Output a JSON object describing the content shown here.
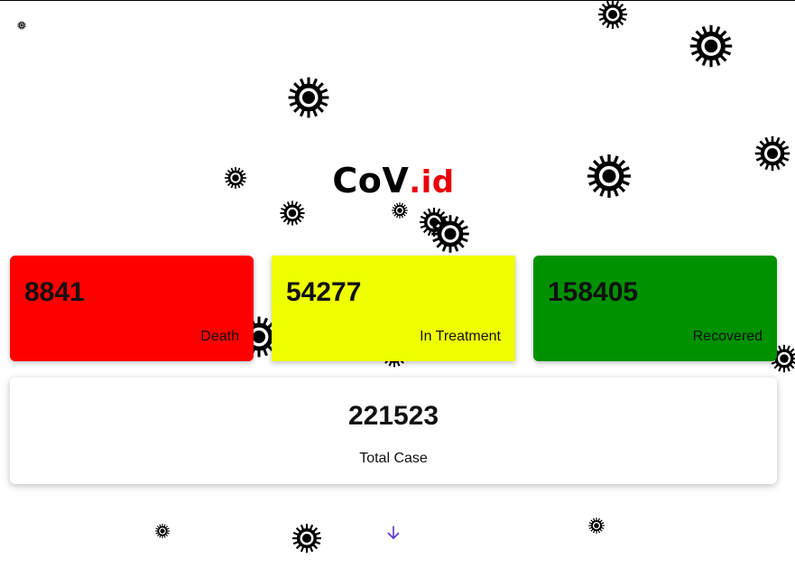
{
  "logo": {
    "main": "CoV",
    "suffix": ".id"
  },
  "stats": {
    "death": {
      "value": "8841",
      "label": "Death"
    },
    "treatment": {
      "value": "54277",
      "label": "In Treatment"
    },
    "recovered": {
      "value": "158405",
      "label": "Recovered"
    }
  },
  "total": {
    "value": "221523",
    "label": "Total Case"
  },
  "scroll": {
    "icon": "arrow-down-icon"
  },
  "decor": {
    "icon": "virus-icon"
  },
  "colors": {
    "death": "#fe0000",
    "treatment": "#eeff00",
    "recovered": "#009100",
    "logo_suffix": "#e8000b",
    "arrow": "#5b2fd6"
  }
}
